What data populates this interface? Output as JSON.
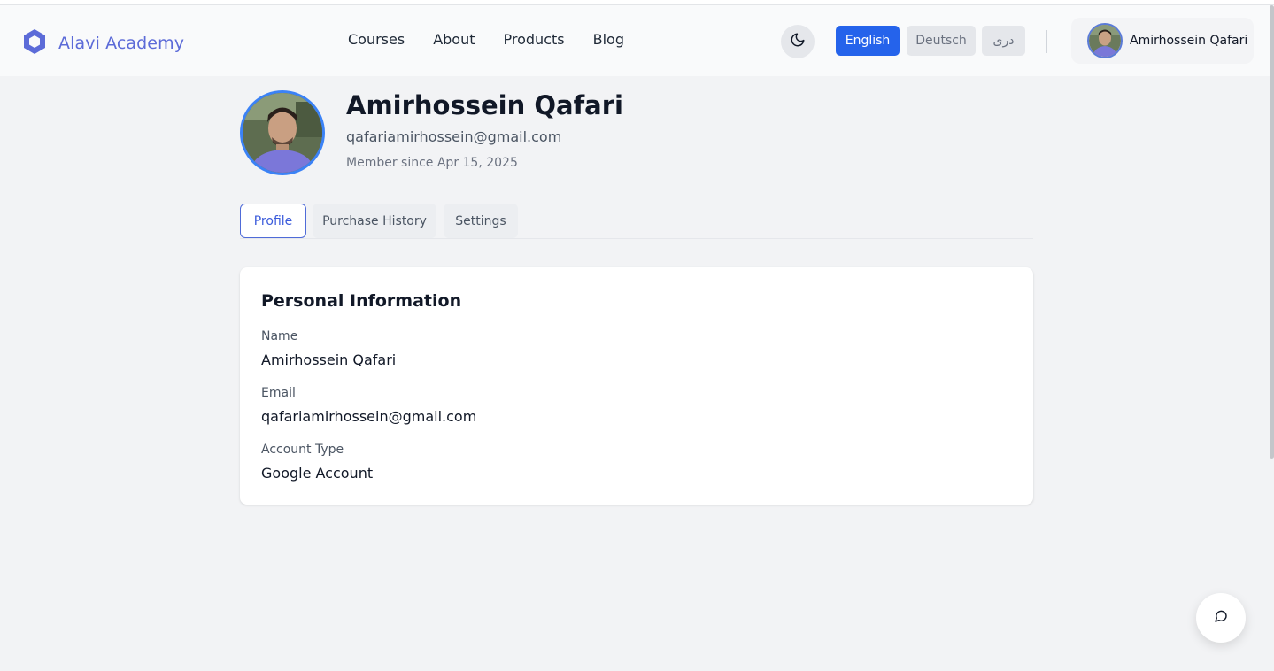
{
  "brand": {
    "name": "Alavi Academy",
    "icon": "hexagon-logo-icon",
    "color": "#5c6bd8"
  },
  "nav": {
    "items": [
      {
        "label": "Courses"
      },
      {
        "label": "About"
      },
      {
        "label": "Products"
      },
      {
        "label": "Blog"
      }
    ]
  },
  "theme_toggle": {
    "icon": "moon-icon"
  },
  "languages": {
    "english": "English",
    "deutsch": "Deutsch",
    "dari": "دری",
    "active": "English",
    "active_color": "#2563eb"
  },
  "user": {
    "name": "Amirhossein Qafari"
  },
  "profile": {
    "name": "Amirhossein Qafari",
    "email": "qafariamirhossein@gmail.com",
    "member_since": "Member since Apr 15, 2025"
  },
  "tabs": {
    "profile": "Profile",
    "purchase_history": "Purchase History",
    "settings": "Settings",
    "active": "Profile"
  },
  "personal_info": {
    "title": "Personal Information",
    "name_label": "Name",
    "name_value": "Amirhossein Qafari",
    "email_label": "Email",
    "email_value": "qafariamirhossein@gmail.com",
    "account_type_label": "Account Type",
    "account_type_value": "Google Account"
  },
  "chat": {
    "icon": "chat-bubble-icon"
  }
}
